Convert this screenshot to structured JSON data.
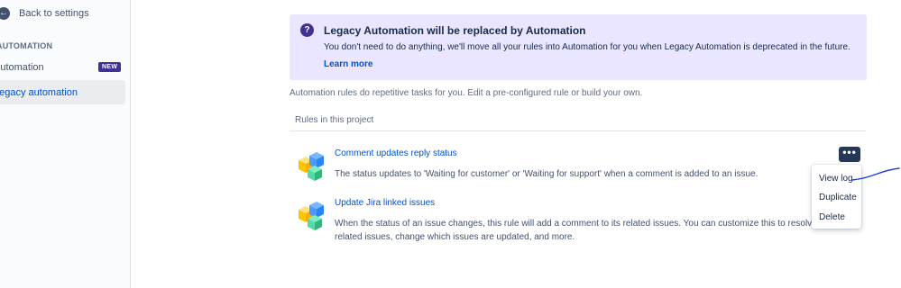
{
  "sidebar": {
    "back_label": "Back to settings",
    "section_title": "AUTOMATION",
    "items": [
      {
        "label": "Automation",
        "badge": "NEW"
      },
      {
        "label": "Legacy automation"
      }
    ]
  },
  "banner": {
    "icon": "question-icon",
    "title": "Legacy Automation will be replaced by Automation",
    "text": "You don't need to do anything, we'll move all your rules into Automation for you when Legacy Automation is deprecated in the future.",
    "link": "Learn more"
  },
  "intro": "Automation rules do repetitive tasks for you. Edit a pre-configured rule or build your own.",
  "rules_header": "Rules in this project",
  "rules": [
    {
      "title": "Comment updates reply status",
      "description": "The status updates to 'Waiting for customer' or 'Waiting for support' when a comment is added to an issue."
    },
    {
      "title": "Update Jira linked issues",
      "description": "When the status of an issue changes, this rule will add a comment to its related issues. You can customize this to resolve related issues, change which issues are updated, and more."
    }
  ],
  "more_button": "•••",
  "menu": {
    "items": [
      "View log",
      "Duplicate",
      "Delete"
    ]
  },
  "colors": {
    "accent": "#0052cc",
    "banner_bg": "#eae6ff",
    "badge": "#403294",
    "more_button": "#253858"
  }
}
